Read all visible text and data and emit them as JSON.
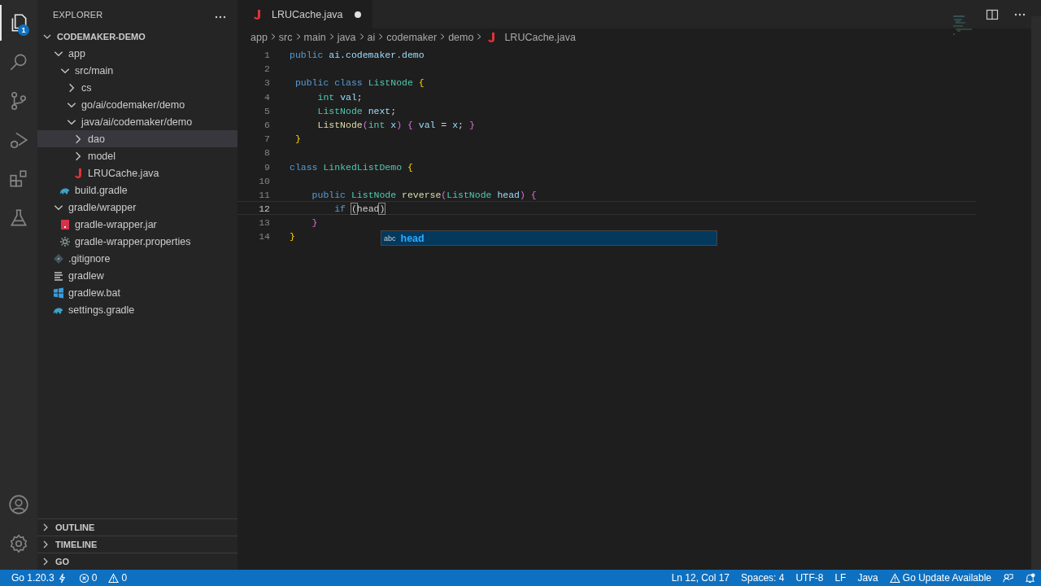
{
  "activity_bar": {
    "items": [
      {
        "kind": "files",
        "selected": true,
        "badge": "1"
      },
      {
        "kind": "search",
        "selected": false
      },
      {
        "kind": "source-control",
        "selected": false
      },
      {
        "kind": "run",
        "selected": false
      },
      {
        "kind": "extensions",
        "selected": false
      },
      {
        "kind": "testing",
        "selected": false
      }
    ],
    "bottom_items": [
      {
        "kind": "account"
      },
      {
        "kind": "settings"
      }
    ]
  },
  "sidebar": {
    "title": "EXPLORER",
    "workspace": {
      "name": "CODEMAKER-DEMO",
      "expanded": true,
      "children": [
        {
          "label": "app",
          "kind": "folder",
          "expanded": true,
          "selected": false,
          "children": [
            {
              "label": "src/main",
              "kind": "folder",
              "expanded": true,
              "selected": false,
              "children": [
                {
                  "label": "cs",
                  "kind": "folder",
                  "expanded": false,
                  "selected": false
                },
                {
                  "label": "go/ai/codemaker/demo",
                  "kind": "folder",
                  "expanded": true,
                  "selected": false
                },
                {
                  "label": "java/ai/codemaker/demo",
                  "kind": "folder",
                  "expanded": true,
                  "selected": false,
                  "children": [
                    {
                      "label": "dao",
                      "kind": "folder",
                      "expanded": false,
                      "selected": true
                    },
                    {
                      "label": "model",
                      "kind": "folder",
                      "expanded": false,
                      "selected": false
                    },
                    {
                      "label": "LRUCache.java",
                      "kind": "java",
                      "selected": false
                    }
                  ]
                }
              ]
            },
            {
              "label": "build.gradle",
              "kind": "gradle",
              "selected": false
            }
          ]
        },
        {
          "label": "gradle/wrapper",
          "kind": "folder",
          "expanded": true,
          "selected": false,
          "children": [
            {
              "label": "gradle-wrapper.jar",
              "kind": "jar",
              "selected": false
            },
            {
              "label": "gradle-wrapper.properties",
              "kind": "properties",
              "selected": false
            }
          ]
        },
        {
          "label": ".gitignore",
          "kind": "gitignore",
          "selected": false
        },
        {
          "label": "gradlew",
          "kind": "text",
          "selected": false
        },
        {
          "label": "gradlew.bat",
          "kind": "bat",
          "selected": false
        },
        {
          "label": "settings.gradle",
          "kind": "gradle",
          "selected": false
        }
      ]
    },
    "panels": [
      {
        "title": "OUTLINE",
        "expanded": false
      },
      {
        "title": "TIMELINE",
        "expanded": false
      },
      {
        "title": "GO",
        "expanded": false
      }
    ]
  },
  "editor": {
    "tabs": [
      {
        "label": "LRUCache.java",
        "kind": "java",
        "selected": true,
        "modified": true
      }
    ],
    "breadcrumbs": [
      {
        "label": "app"
      },
      {
        "label": "src"
      },
      {
        "label": "main"
      },
      {
        "label": "java"
      },
      {
        "label": "ai"
      },
      {
        "label": "codemaker"
      },
      {
        "label": "demo"
      },
      {
        "label": "LRUCache.java",
        "kind": "java"
      }
    ],
    "lines": [
      {
        "number": "1",
        "current": false,
        "tokens": [
          {
            "text": "public ",
            "kind": "keyword"
          },
          {
            "text": "ai.codemaker.demo",
            "kind": "variable"
          }
        ]
      },
      {
        "number": "2",
        "current": false
      },
      {
        "number": "3",
        "current": false,
        "tokens": [
          {
            "text": " public class ",
            "kind": "keyword"
          },
          {
            "text": "ListNode ",
            "kind": "type"
          },
          {
            "text": "{",
            "kind": "brace1"
          }
        ]
      },
      {
        "number": "4",
        "current": false,
        "tokens": [
          {
            "text": "     int ",
            "kind": "type"
          },
          {
            "text": "val",
            "kind": "variable"
          },
          {
            "text": ";"
          }
        ]
      },
      {
        "number": "5",
        "current": false,
        "tokens": [
          {
            "text": "     ListNode ",
            "kind": "type"
          },
          {
            "text": "next",
            "kind": "variable"
          },
          {
            "text": ";"
          }
        ]
      },
      {
        "number": "6",
        "current": false,
        "tokens": [
          {
            "text": "     ListNode",
            "kind": "function"
          },
          {
            "text": "(",
            "kind": "brace2"
          },
          {
            "text": "int ",
            "kind": "type"
          },
          {
            "text": "x",
            "kind": "variable"
          },
          {
            "text": ") { ",
            "kind": "brace2"
          },
          {
            "text": "val",
            "kind": "variable"
          },
          {
            "text": " = "
          },
          {
            "text": "x",
            "kind": "variable"
          },
          {
            "text": "; "
          },
          {
            "text": "}",
            "kind": "brace2"
          }
        ]
      },
      {
        "number": "7",
        "current": false,
        "tokens": [
          {
            "text": " }",
            "kind": "brace1"
          }
        ]
      },
      {
        "number": "8",
        "current": false
      },
      {
        "number": "9",
        "current": false,
        "tokens": [
          {
            "text": "class ",
            "kind": "keyword"
          },
          {
            "text": "LinkedListDemo ",
            "kind": "type"
          },
          {
            "text": "{",
            "kind": "brace1"
          }
        ]
      },
      {
        "number": "10",
        "current": false
      },
      {
        "number": "11",
        "current": false,
        "tokens": [
          {
            "text": "    public ",
            "kind": "keyword"
          },
          {
            "text": "ListNode ",
            "kind": "type"
          },
          {
            "text": "reverse",
            "kind": "function"
          },
          {
            "text": "(",
            "kind": "brace2"
          },
          {
            "text": "ListNode ",
            "kind": "type"
          },
          {
            "text": "head",
            "kind": "variable"
          },
          {
            "text": ") {",
            "kind": "brace2"
          }
        ]
      },
      {
        "number": "12",
        "current": true,
        "tokens": [
          {
            "text": "        if ",
            "kind": "keyword"
          },
          {
            "text": "(",
            "kind": "brace3"
          },
          {
            "text": "head"
          },
          {
            "text": ")",
            "kind": "brace3"
          }
        ]
      },
      {
        "number": "13",
        "current": false,
        "tokens": [
          {
            "text": "    }",
            "kind": "brace2"
          }
        ]
      },
      {
        "number": "14",
        "current": false,
        "tokens": [
          {
            "text": "}",
            "kind": "brace1"
          }
        ]
      }
    ],
    "suggestion": {
      "kind_label": "abc",
      "text": "head",
      "selected": true
    }
  },
  "status_bar": {
    "left": [
      {
        "text": "Go 1.20.3",
        "kind": "version"
      },
      {
        "text": "0",
        "kind": "errors"
      },
      {
        "text": "0",
        "kind": "warnings"
      }
    ],
    "right": [
      {
        "text": "Ln 12, Col 17",
        "kind": "text"
      },
      {
        "text": "Spaces: 4",
        "kind": "text"
      },
      {
        "text": "UTF-8",
        "kind": "text"
      },
      {
        "text": "LF",
        "kind": "text"
      },
      {
        "text": "Java",
        "kind": "text"
      },
      {
        "text": "Go Update Available",
        "kind": "notice"
      },
      {
        "kind": "feedback"
      },
      {
        "kind": "notifications"
      }
    ]
  }
}
